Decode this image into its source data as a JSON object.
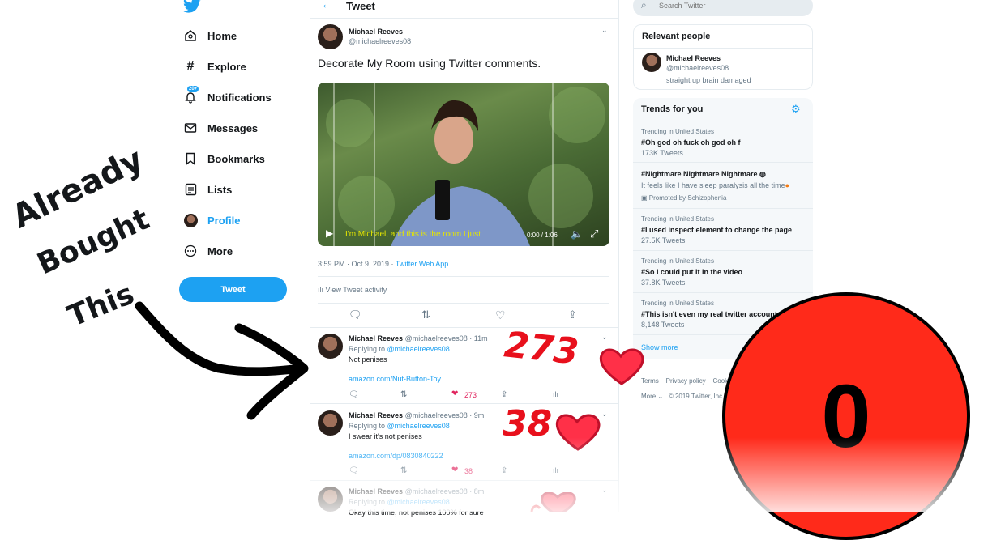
{
  "nav": {
    "items": [
      {
        "label": "Home",
        "icon": "home-icon"
      },
      {
        "label": "Explore",
        "icon": "hash-icon"
      },
      {
        "label": "Notifications",
        "icon": "bell-icon",
        "badge": "20+"
      },
      {
        "label": "Messages",
        "icon": "mail-icon"
      },
      {
        "label": "Bookmarks",
        "icon": "bookmark-icon"
      },
      {
        "label": "Lists",
        "icon": "list-icon"
      },
      {
        "label": "Profile",
        "icon": "avatar-icon"
      },
      {
        "label": "More",
        "icon": "more-icon"
      }
    ],
    "tweet_button": "Tweet"
  },
  "header": {
    "title": "Tweet"
  },
  "main_tweet": {
    "name": "Michael Reeves",
    "handle": "@michaelreeves08",
    "text": "Decorate My Room using Twitter comments.",
    "video_caption": "I'm Michael, and this is the room I just",
    "video_time": "0:00 / 1:06",
    "timestamp": "3:59 PM · Oct 9, 2019 · ",
    "source": "Twitter Web App",
    "activity": "View Tweet activity"
  },
  "replies": [
    {
      "name": "Michael Reeves",
      "meta": "@michaelreeves08 · 11m",
      "replying": "Replying to ",
      "replying_to": "@michaelreeves08",
      "text": "Not penises",
      "link": "amazon.com/Nut-Button-Toy...",
      "likes": "273"
    },
    {
      "name": "Michael Reeves",
      "meta": "@michaelreeves08 · 9m",
      "replying": "Replying to ",
      "replying_to": "@michaelreeves08",
      "text": "I swear it's not penises",
      "link": "amazon.com/dp/0830840222",
      "likes": "38"
    },
    {
      "name": "Michael Reeves",
      "meta": "@michaelreeves08 · 8m",
      "replying": "Replying to ",
      "replying_to": "@michaelreeves08",
      "text": "Okay this time, not penises 100% for sure"
    }
  ],
  "search": {
    "placeholder": "Search Twitter"
  },
  "relevant": {
    "title": "Relevant people",
    "name": "Michael Reeves",
    "handle": "@michaelreeves08",
    "bio": "straight up brain damaged"
  },
  "trends": {
    "title": "Trends for you",
    "items": [
      {
        "sub": "Trending in United States",
        "main": "#Oh god oh fuck oh god oh f",
        "count": "173K Tweets"
      },
      {
        "main": "#Nightmare Nightmare Nightmare",
        "desc": "It feels like I have sleep paralysis all the time",
        "promo": "Promoted by Schizophenia"
      },
      {
        "sub": "Trending in United States",
        "main": "#I used inspect element to change the page",
        "count": "27.5K Tweets"
      },
      {
        "sub": "Trending in United States",
        "main": "#So I could put it in the video",
        "count": "37.8K Tweets"
      },
      {
        "sub": "Trending in United States",
        "main": "#This isn't even my real twitter account",
        "count": "8,148 Tweets"
      }
    ],
    "show_more": "Show more"
  },
  "footer": {
    "terms": "Terms",
    "privacy": "Privacy policy",
    "cookies": "Cookies",
    "more": "More",
    "copyright": "© 2019 Twitter, Inc."
  },
  "overlay": {
    "handwriting": [
      "Already",
      "Bought",
      "This"
    ],
    "counter": "0",
    "hearts": [
      "273",
      "38"
    ]
  },
  "colors": {
    "accent": "#1da1f2",
    "like": "#e0245e",
    "counter_fill": "#ff2a1a",
    "scribble": "#e8101c"
  }
}
